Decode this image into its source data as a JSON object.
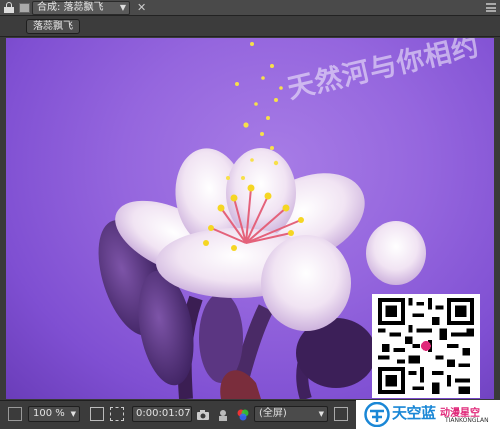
{
  "panel": {
    "comp_tab_label": "合成: 落蕊飘飞",
    "breadcrumb_label": "落蕊飘飞"
  },
  "viewer": {
    "watermark_text": "天然河与你相约"
  },
  "toolbar": {
    "zoom_value": "100 %",
    "timecode": "0:00:01:07",
    "resolution_value": "(全屏)"
  },
  "branding": {
    "logo_text": "天空蓝",
    "logo_subtitle": "动漫星空",
    "logo_en": "TIANKONGLAN"
  },
  "colors": {
    "panel_bg": "#3a3a3a",
    "viewer_purple": "#9566de",
    "logo_blue": "#1a87d6",
    "logo_pink": "#e0297a"
  },
  "icons": [
    "lock-icon",
    "comp-tab-icon",
    "close-icon",
    "panel-menu-icon",
    "always-preview-icon",
    "region-of-interest-icon",
    "transparency-grid-icon",
    "snapshot-icon",
    "show-snapshot-icon",
    "channel-icon",
    "fast-previews-icon"
  ]
}
